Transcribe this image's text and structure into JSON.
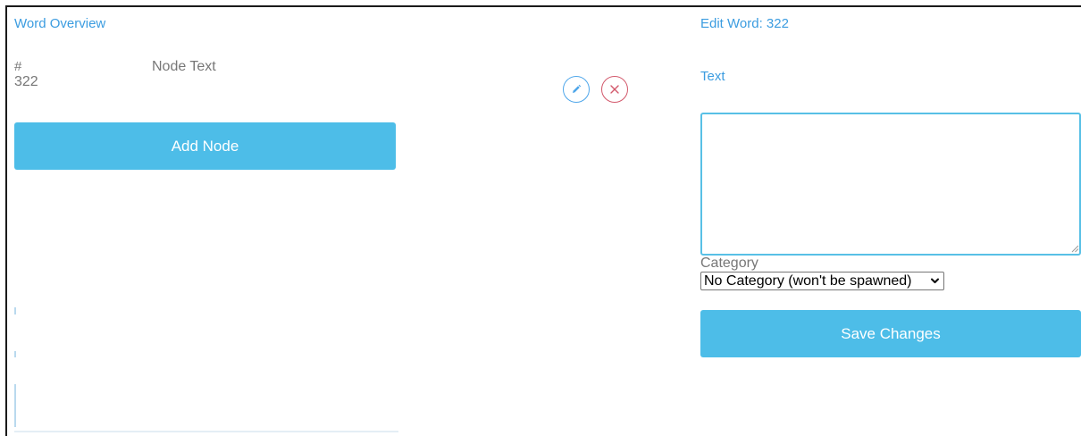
{
  "overview": {
    "title": "Word Overview",
    "columns": {
      "id": "#",
      "text": "Node Text"
    },
    "rows": [
      {
        "id": "322",
        "text": ""
      }
    ],
    "add_button": "Add Node"
  },
  "editor": {
    "title": "Edit Word: 322",
    "text_label": "Text",
    "text_value": "",
    "category_label": "Category",
    "category_selected": "No Category (won't be spawned)",
    "save_button": "Save Changes"
  },
  "icons": {
    "edit": "pencil-icon",
    "delete": "close-icon",
    "dropdown": "chevron-down-icon"
  },
  "colors": {
    "accent": "#4dbde8",
    "title_blue": "#3b9ce0",
    "edit_blue": "#4ea6ea",
    "delete_red": "#d2586b"
  }
}
